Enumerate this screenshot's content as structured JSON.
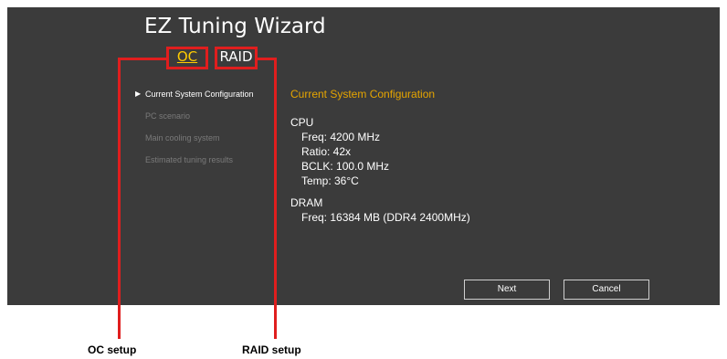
{
  "window": {
    "title": "EZ Tuning Wizard"
  },
  "tabs": [
    {
      "label": "OC",
      "active": true
    },
    {
      "label": "RAID",
      "active": false
    }
  ],
  "steps": [
    {
      "label": "Current System Configuration",
      "active": true
    },
    {
      "label": "PC scenario",
      "active": false
    },
    {
      "label": "Main cooling system",
      "active": false
    },
    {
      "label": "Estimated tuning results",
      "active": false
    }
  ],
  "content": {
    "section_title": "Current System Configuration",
    "cpu": {
      "heading": "CPU",
      "freq": "Freq: 4200 MHz",
      "ratio": "Ratio: 42x",
      "bclk": "BCLK: 100.0 MHz",
      "temp": "Temp: 36°C"
    },
    "dram": {
      "heading": "DRAM",
      "freq": "Freq: 16384 MB (DDR4 2400MHz)"
    }
  },
  "buttons": {
    "next": "Next",
    "cancel": "Cancel"
  },
  "callouts": {
    "oc": "OC setup",
    "raid": "RAID setup"
  },
  "colors": {
    "panel_bg": "#3b3b3b",
    "accent": "#ffcc00",
    "section_title": "#e6a500",
    "callout_red": "#e01e1e"
  },
  "icons": {
    "active_step": "triangle-right-icon"
  }
}
